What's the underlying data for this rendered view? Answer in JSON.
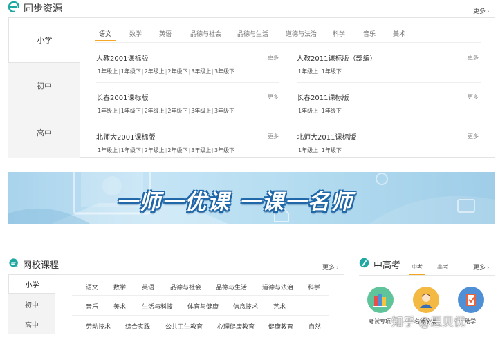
{
  "sync": {
    "title": "同步资源",
    "more": "更多",
    "levels": [
      "小学",
      "初中",
      "高中"
    ],
    "subjects": [
      "语文",
      "数学",
      "英语",
      "品德与社会",
      "品德与生活",
      "道德与法治",
      "科学",
      "音乐",
      "美术"
    ],
    "editions_left": [
      {
        "name": "人教2001课标版",
        "more": "更多",
        "grades": [
          "1年级上",
          "1年级下",
          "2年级上",
          "2年级下",
          "3年级上",
          "3年级下"
        ]
      },
      {
        "name": "长春2001课标版",
        "more": "更多",
        "grades": [
          "1年级上",
          "1年级下",
          "2年级上",
          "2年级下",
          "3年级上",
          "3年级下"
        ]
      },
      {
        "name": "北师大2001课标版",
        "more": "更多",
        "grades": [
          "1年级上",
          "1年级下",
          "2年级上",
          "2年级下",
          "3年级上",
          "3年级下"
        ]
      }
    ],
    "editions_right": [
      {
        "name": "人教2011课标版（部编）",
        "more": "更多",
        "grades": [
          "1年级上",
          "1年级下"
        ]
      },
      {
        "name": "长春2011课标版",
        "more": "更多",
        "grades": [
          "1年级上",
          "1年级下"
        ]
      },
      {
        "name": "北师大2011课标版",
        "more": "更多",
        "grades": [
          "1年级上",
          "1年级下"
        ]
      }
    ]
  },
  "banner": {
    "text": "一师一优课  一课一名师"
  },
  "courses": {
    "title": "网校课程",
    "more": "更多",
    "levels": [
      "小学",
      "初中",
      "高中"
    ],
    "rows": [
      [
        "语文",
        "数学",
        "英语",
        "品德与社会",
        "品德与生活",
        "道德与法治",
        "科学"
      ],
      [
        "音乐",
        "美术",
        "生活与科技",
        "体育与健康",
        "信息技术",
        "艺术"
      ],
      [
        "劳动技术",
        "综合实践",
        "公共卫生教育",
        "心理健康教育",
        "健康教育",
        "自然"
      ]
    ]
  },
  "exam": {
    "title": "中高考",
    "more": "更多",
    "tabs": [
      "中考",
      "高考"
    ],
    "items": [
      {
        "label": "考试专项",
        "icon": "books-icon"
      },
      {
        "label": "名师讲堂",
        "icon": "teacher-icon"
      },
      {
        "label": "助学",
        "icon": "notebook-icon"
      }
    ]
  },
  "watermark": "知乎 @思贝优",
  "colors": {
    "accent": "#f5a623",
    "brand_teal": "#21a5a0",
    "banner_text_stroke": "#1f67a8"
  }
}
